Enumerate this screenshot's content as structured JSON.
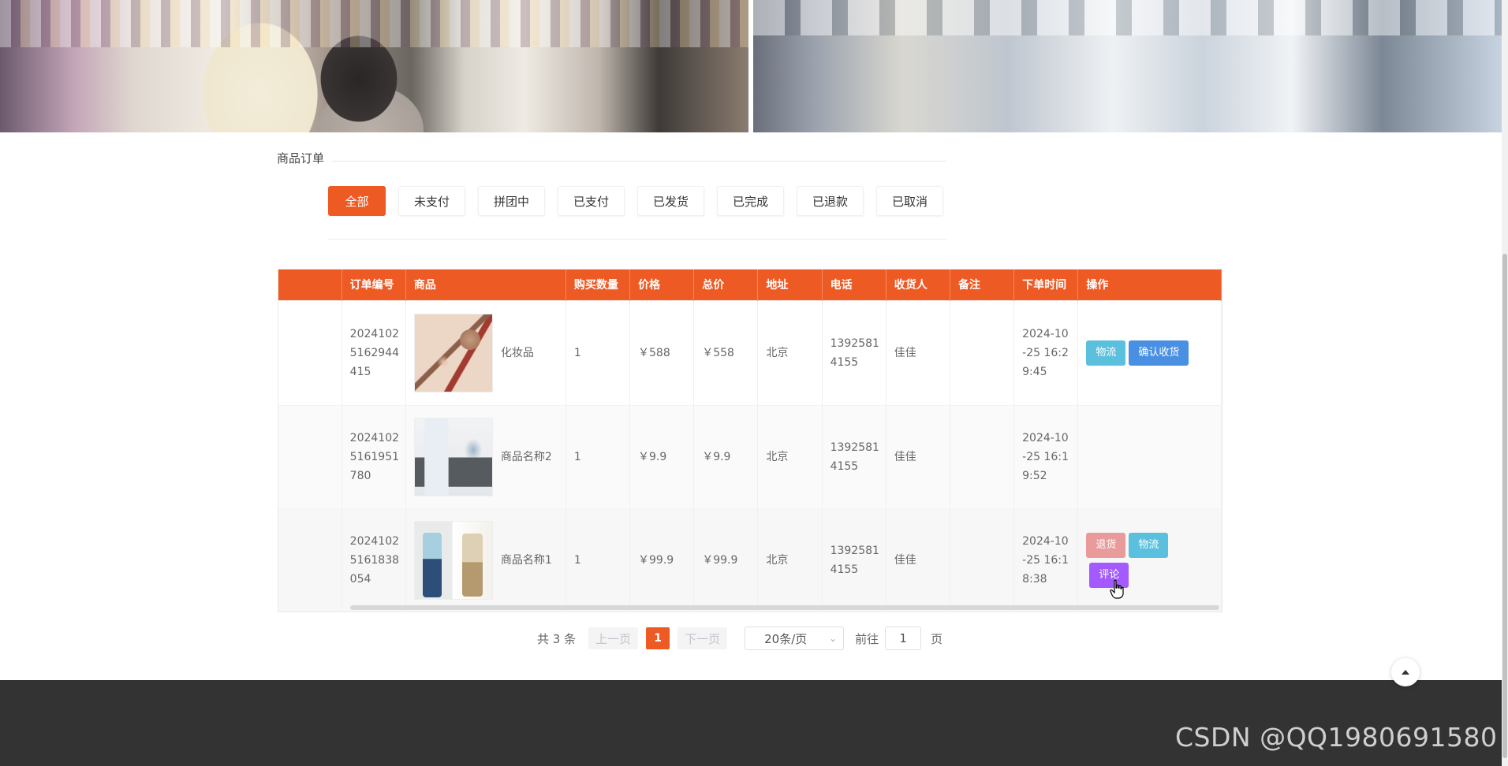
{
  "section_title": "商品订单",
  "tabs": [
    {
      "label": "全部",
      "active": true
    },
    {
      "label": "未支付",
      "active": false
    },
    {
      "label": "拼团中",
      "active": false
    },
    {
      "label": "已支付",
      "active": false
    },
    {
      "label": "已发货",
      "active": false
    },
    {
      "label": "已完成",
      "active": false
    },
    {
      "label": "已退款",
      "active": false
    },
    {
      "label": "已取消",
      "active": false
    }
  ],
  "table": {
    "columns": [
      "",
      "订单编号",
      "商品",
      "购买数量",
      "价格",
      "总价",
      "地址",
      "电话",
      "收货人",
      "备注",
      "下单时间",
      "操作"
    ],
    "rows": [
      {
        "order_no": "2024102\n5162944\n415",
        "product": "化妆品",
        "thumb": "cosmetics-image",
        "qty": "1",
        "price": "￥588",
        "total": "￥558",
        "address": "北京",
        "phone": "1392581\n4155",
        "receiver": "佳佳",
        "note": "",
        "time": "2024-10\n-25 16:2\n9:45",
        "actions": [
          {
            "label": "物流",
            "color": "#5bc0de"
          },
          {
            "label": "确认收货",
            "color": "#4a90e2"
          }
        ]
      },
      {
        "order_no": "2024102\n5161951\n780",
        "product": "商品名称2",
        "thumb": "clothing-image",
        "qty": "1",
        "price": "￥9.9",
        "total": "￥9.9",
        "address": "北京",
        "phone": "1392581\n4155",
        "receiver": "佳佳",
        "note": "",
        "time": "2024-10\n-25 16:1\n9:52",
        "actions": []
      },
      {
        "order_no": "2024102\n5161838\n054",
        "product": "商品名称1",
        "thumb": "clothing-image",
        "qty": "1",
        "price": "￥99.9",
        "total": "￥99.9",
        "address": "北京",
        "phone": "1392581\n4155",
        "receiver": "佳佳",
        "note": "",
        "time": "2024-10\n-25 16:1\n8:38",
        "actions": [
          {
            "label": "退货",
            "color": "#e99a9a"
          },
          {
            "label": "物流",
            "color": "#5bc0de"
          },
          {
            "label": "评论",
            "color": "#a35bff"
          }
        ]
      }
    ]
  },
  "pagination": {
    "total": "共 3 条",
    "prev": "上一页",
    "current": "1",
    "next": "下一页",
    "page_size": "20条/页",
    "goto_label": "前往",
    "goto_value": "1",
    "page_suffix": "页"
  },
  "watermark": "CSDN @QQ1980691580",
  "colors": {
    "accent": "#ee5a24",
    "footer": "#333333"
  }
}
